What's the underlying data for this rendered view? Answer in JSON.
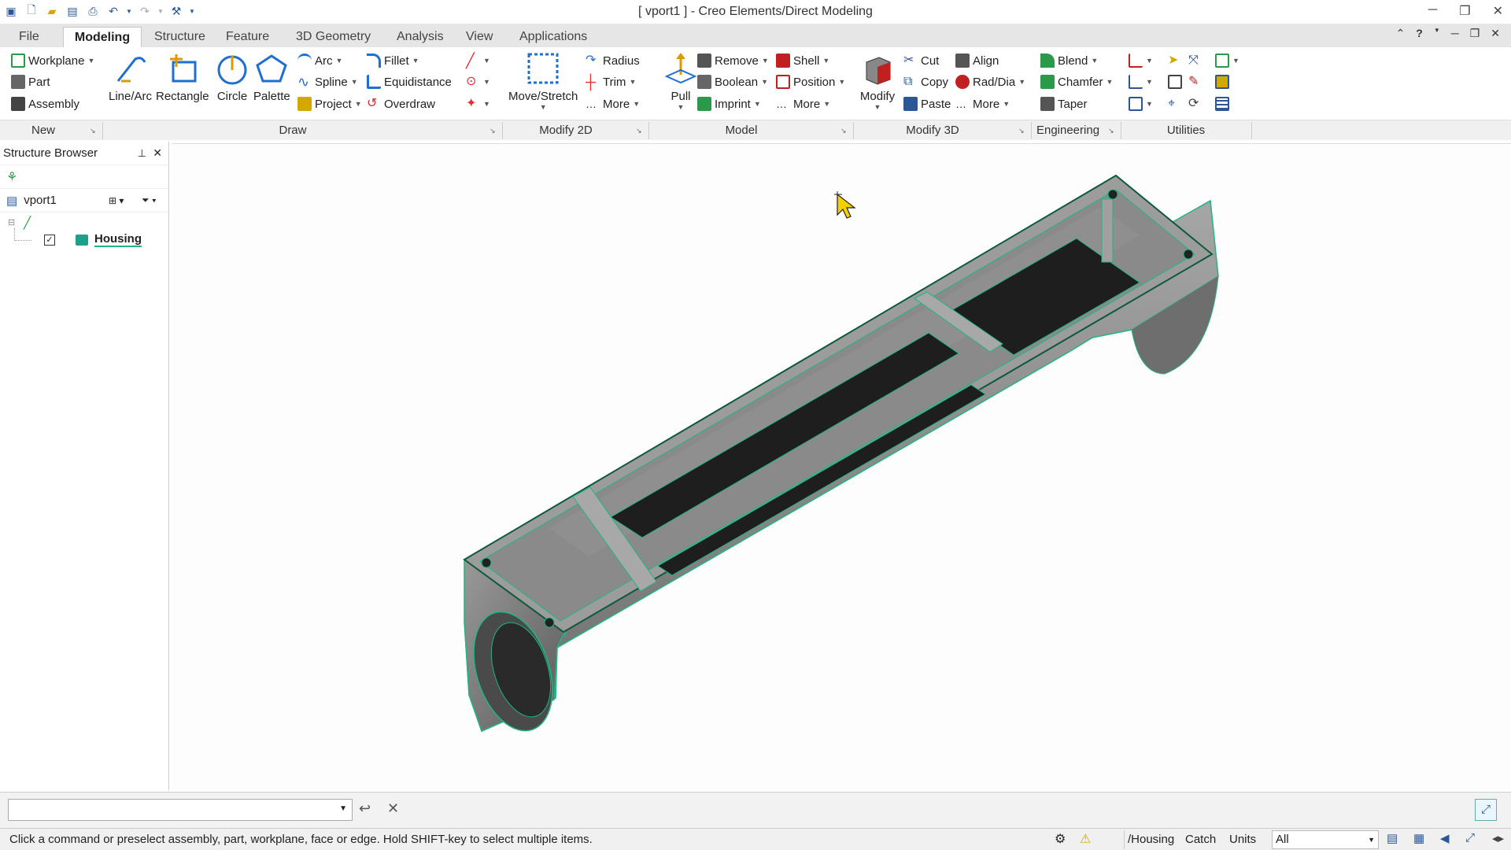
{
  "window": {
    "title": "[ vport1 ] - Creo Elements/Direct Modeling"
  },
  "tabs": [
    "File",
    "Modeling",
    "Structure",
    "Feature",
    "3D Geometry",
    "Analysis",
    "View",
    "Applications"
  ],
  "ribbon": {
    "new": {
      "workplane": "Workplane",
      "part": "Part",
      "assembly": "Assembly"
    },
    "draw": {
      "line_arc": "Line/Arc",
      "rectangle": "Rectangle",
      "circle": "Circle",
      "palette": "Palette",
      "arc": "Arc",
      "spline": "Spline",
      "project": "Project",
      "fillet": "Fillet",
      "equidistance": "Equidistance",
      "overdraw": "Overdraw"
    },
    "modify2d": {
      "move_stretch": "Move/Stretch",
      "radius": "Radius",
      "trim": "Trim",
      "more": "More"
    },
    "model": {
      "pull": "Pull",
      "remove": "Remove",
      "boolean": "Boolean",
      "imprint": "Imprint",
      "shell": "Shell",
      "position": "Position",
      "more": "More"
    },
    "modify3d": {
      "modify": "Modify",
      "cut": "Cut",
      "copy": "Copy",
      "paste": "Paste",
      "align": "Align",
      "rad_dia": "Rad/Dia",
      "more": "More"
    },
    "engineering": {
      "blend": "Blend",
      "chamfer": "Chamfer",
      "taper": "Taper"
    },
    "groups": [
      "New",
      "Draw",
      "Modify 2D",
      "Model",
      "Modify 3D",
      "Engineering",
      "Utilities"
    ]
  },
  "structure_browser": {
    "title": "Structure Browser",
    "root": "vport1",
    "part": "Housing"
  },
  "status": {
    "message": "Click a command or preselect assembly, part, workplane, face or edge. Hold SHIFT-key to select multiple items.",
    "path": "/Housing",
    "catch": "Catch",
    "units": "Units",
    "filter": "All"
  },
  "colors": {
    "edge": "#1fb585",
    "body": "#8f8f8f",
    "dark_face": "#1e1e1e",
    "tab_bar": "#e6e6e6"
  }
}
